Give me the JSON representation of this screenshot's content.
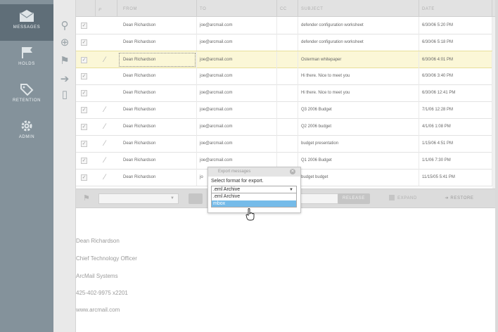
{
  "nav": {
    "items": [
      {
        "label": "MESSAGES",
        "icon": "envelope-icon"
      },
      {
        "label": "HOLDS",
        "icon": "flag-icon"
      },
      {
        "label": "RETENTION",
        "icon": "tag-icon"
      },
      {
        "label": "ADMIN",
        "icon": "gear-icon"
      }
    ]
  },
  "table": {
    "columns": [
      "FROM",
      "TO",
      "CC",
      "SUBJECT",
      "DATE"
    ],
    "rows": [
      {
        "from": "Dean Richardson",
        "to": "joe@arcmail.com",
        "subject": "defender configuration worksheet",
        "date": "6/30/06 5:20 PM",
        "attachment": false
      },
      {
        "from": "Dean Richardson",
        "to": "joe@arcmail.com",
        "subject": "defender configuration worksheet",
        "date": "6/30/06 5:18 PM",
        "attachment": false
      },
      {
        "from": "Dean Richardson",
        "to": "joe@arcmail.com",
        "subject": "Osterman whitepaper",
        "date": "6/30/06 4:01 PM",
        "attachment": true
      },
      {
        "from": "Dean Richardson",
        "to": "joe@arcmail.com",
        "subject": "Hi there. Nice to meet you",
        "date": "6/30/06 3:40 PM",
        "attachment": false
      },
      {
        "from": "Dean Richardson",
        "to": "joe@arcmail.com",
        "subject": "Hi there. Nice to meet you",
        "date": "6/30/06 12:41 PM",
        "attachment": false
      },
      {
        "from": "Dean Richardson",
        "to": "joe@arcmail.com",
        "subject": "Q3 2006 Budget",
        "date": "7/1/06 12:28 PM",
        "attachment": true
      },
      {
        "from": "Dean Richardson",
        "to": "joe@arcmail.com",
        "subject": "Q2 2006 budget",
        "date": "4/1/06 1:08 PM",
        "attachment": true
      },
      {
        "from": "Dean Richardson",
        "to": "joe@arcmail.com",
        "subject": "budget presentation",
        "date": "1/15/06 4:51 PM",
        "attachment": true
      },
      {
        "from": "Dean Richardson",
        "to": "joe@arcmail.com",
        "subject": "Q1 2006 Budget",
        "date": "1/1/06 7:30 PM",
        "attachment": true
      },
      {
        "from": "Dean Richardson",
        "to": "jo",
        "subject": "budget budget",
        "date": "11/15/05 5:41 PM",
        "attachment": true
      }
    ],
    "selected_row": 2
  },
  "toolbar": {
    "release_label": "RELEASE",
    "expand_label": "EXPAND",
    "restore_label": "RESTORE"
  },
  "modal": {
    "title": "Export messages",
    "prompt": "Select format for export.",
    "selected": ".eml Archive",
    "options": [
      ".eml Archive",
      "mbox"
    ],
    "highlighted": 1
  },
  "preview": {
    "signature": [
      "Dean Richardson",
      "Chief Technology Officer",
      "ArcMail Systems",
      "425-402-9975 x2201",
      "www.arcmail.com"
    ]
  },
  "colors": {
    "nav_bg": "#84929b",
    "nav_active": "#5f6e78",
    "selected_row": "#fbf7d7",
    "option_highlight": "#75bbe9"
  }
}
